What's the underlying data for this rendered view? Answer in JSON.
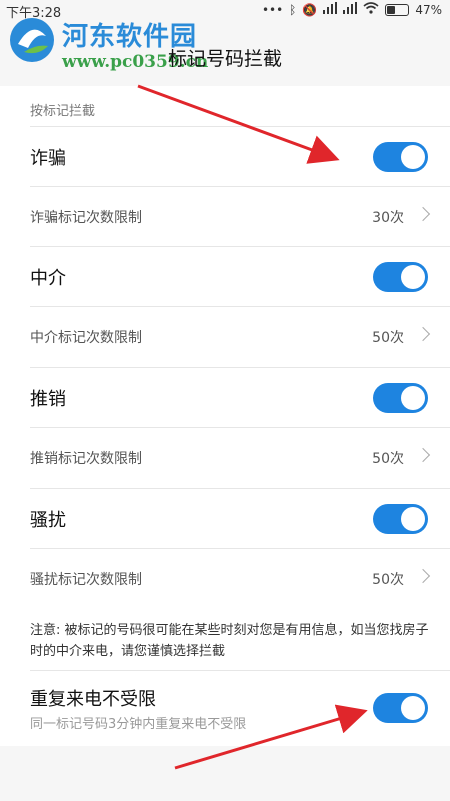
{
  "status_bar": {
    "time": "下午3:28",
    "dots": "•••",
    "battery_percent": "47%"
  },
  "watermark": {
    "title": "河东软件园",
    "url": "www.pc0359.cn"
  },
  "page": {
    "title": "标记号码拦截"
  },
  "section": {
    "label": "按标记拦截"
  },
  "categories": [
    {
      "name": "诈骗",
      "enabled": true,
      "limit_label": "诈骗标记次数限制",
      "limit_value": "30次"
    },
    {
      "name": "中介",
      "enabled": true,
      "limit_label": "中介标记次数限制",
      "limit_value": "50次"
    },
    {
      "name": "推销",
      "enabled": true,
      "limit_label": "推销标记次数限制",
      "limit_value": "50次"
    },
    {
      "name": "骚扰",
      "enabled": true,
      "limit_label": "骚扰标记次数限制",
      "limit_value": "50次"
    }
  ],
  "note": {
    "text": "注意: 被标记的号码很可能在某些时刻对您是有用信息，如当您找房子时的中介来电，请您谨慎选择拦截"
  },
  "repeat_call": {
    "title": "重复来电不受限",
    "subtitle": "同一标记号码3分钟内重复来电不受限",
    "enabled": true
  },
  "colors": {
    "toggle_on": "#1e84e0",
    "annotation_arrow": "#e0262b",
    "watermark_title": "#2a8bd8",
    "watermark_url": "#3aa04a"
  }
}
